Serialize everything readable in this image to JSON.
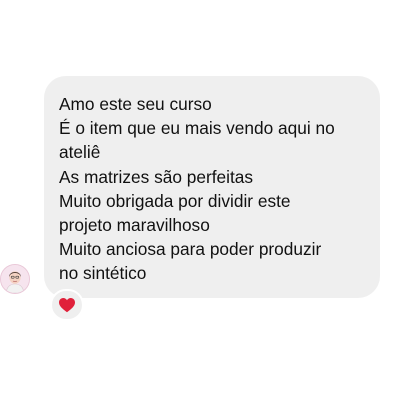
{
  "chat": {
    "message": {
      "lines": [
        "Amo este seu curso",
        "É o item que eu mais vendo aqui no",
        "ateliê",
        "As matrizes são perfeitas",
        "Muito obrigada por dividir este",
        "projeto maravilhoso",
        "Muito anciosa para poder produzir",
        "no sintético"
      ]
    },
    "sender": {
      "avatar_icon": "profile-photo"
    },
    "reaction": {
      "icon": "heart-icon",
      "color": "#e0203a"
    }
  },
  "colors": {
    "bubble_background": "#efefef",
    "text": "#111111",
    "background": "#ffffff"
  }
}
